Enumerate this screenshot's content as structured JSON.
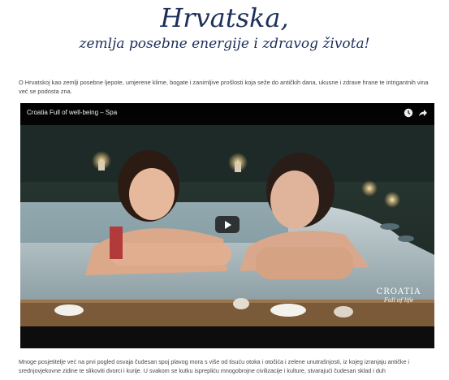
{
  "header": {
    "title": "Hrvatska,",
    "subtitle": "zemlja posebne energije i zdravog života!"
  },
  "intro": {
    "text": "O Hrvatskoj kao zemlji posebne ljepote, umjerene klime, bogate i zanimljive prošlosti koja seže do antičkih dana, ukusne i zdrave hrane te intrigantnih vina već se podosta zna."
  },
  "video": {
    "title": "Croatia Full of well-being – Spa",
    "icons": [
      "clock-icon",
      "share-icon",
      "play-icon"
    ],
    "logo": {
      "main": "CROATIA",
      "sub": "Full of life"
    }
  },
  "body": {
    "text": "Mnoge posjetitelje već na prvi pogled osvaja čudesan spoj plavog mora s više od tisuću otoka i otočića i zelene unutrašnjosti, iz kojeg izranjaju antičke i srednjovjekovne zidine te slikoviti dvorci i kurije. U svakom se kutku isprepliću mnogobrojne civilizacije i kulture, stvarajući čudesan sklad i duh"
  }
}
